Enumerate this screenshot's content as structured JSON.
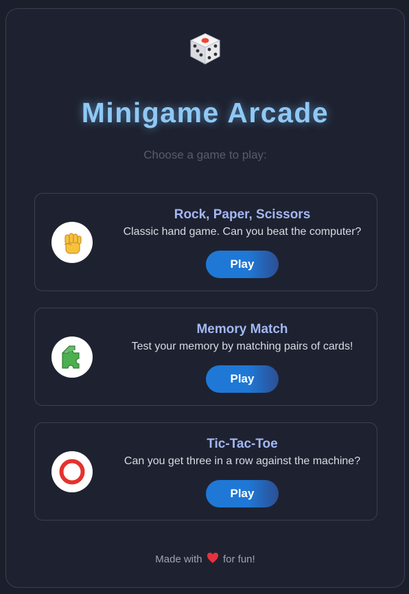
{
  "header": {
    "logo_icon": "dice-icon",
    "title": "Minigame Arcade",
    "subtitle": "Choose a game to play:"
  },
  "games": [
    {
      "icon": "raised-fist-icon",
      "title": "Rock, Paper, Scissors",
      "description": "Classic hand game. Can you beat the computer?",
      "button_label": "Play"
    },
    {
      "icon": "puzzle-piece-icon",
      "title": "Memory Match",
      "description": "Test your memory by matching pairs of cards!",
      "button_label": "Play"
    },
    {
      "icon": "red-circle-icon",
      "title": "Tic-Tac-Toe",
      "description": "Can you get three in a row against the machine?",
      "button_label": "Play"
    }
  ],
  "footer": {
    "prefix": "Made with",
    "heart_icon": "heart-icon",
    "suffix": "for fun!"
  },
  "colors": {
    "background": "#1a1f2b",
    "title": "#8fc9f5",
    "card_title": "#a3b7f3",
    "button": "#1f78d6"
  }
}
